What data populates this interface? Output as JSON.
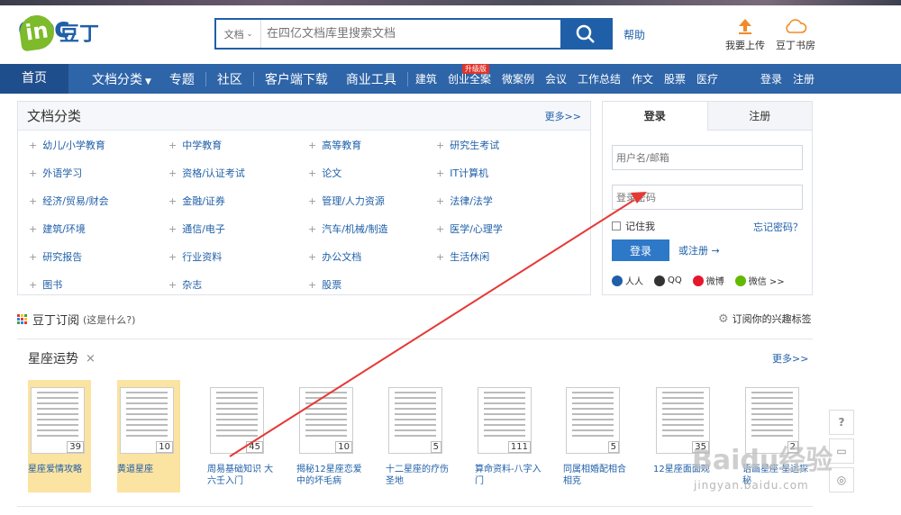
{
  "logo": {
    "brand": "doc",
    "badge": "in",
    "cn": "豆丁"
  },
  "search": {
    "type_label": "文档",
    "placeholder": "在四亿文档库里搜索文档"
  },
  "help": "帮助",
  "tools": [
    {
      "label": "我要上传",
      "icon": "upload-icon"
    },
    {
      "label": "豆丁书房",
      "icon": "cloud-icon"
    }
  ],
  "nav": {
    "main": [
      "首页",
      "文档分类",
      "专题",
      "社区",
      "客户端下载",
      "商业工具"
    ],
    "small": [
      "建筑",
      "创业全案",
      "微案例",
      "会议",
      "工作总结",
      "作文",
      "股票",
      "医疗"
    ],
    "badge": "升级版",
    "login": "登录",
    "register": "注册"
  },
  "categories": {
    "title": "文档分类",
    "more": "更多>>",
    "items": [
      "幼儿/小学教育",
      "中学教育",
      "高等教育",
      "研究生考试",
      "外语学习",
      "资格/认证考试",
      "论文",
      "IT计算机",
      "经济/贸易/财会",
      "金融/证券",
      "管理/人力资源",
      "法律/法学",
      "建筑/环境",
      "通信/电子",
      "汽车/机械/制造",
      "医学/心理学",
      "研究报告",
      "行业资料",
      "办公文档",
      "生活休闲",
      "图书",
      "杂志",
      "股票"
    ]
  },
  "login": {
    "tab_login": "登录",
    "tab_register": "注册",
    "username_placeholder": "用户名/邮箱",
    "password_placeholder": "登录密码",
    "remember": "记住我",
    "forgot": "忘记密码？",
    "submit": "登录",
    "or_register": "或注册 →",
    "social": [
      "人人",
      "QQ",
      "微博",
      "微信 >>"
    ]
  },
  "subscribe": {
    "title": "豆丁订阅",
    "hint": "(这是什么?)",
    "right": "订阅你的兴趣标签"
  },
  "section": {
    "title": "星座运势",
    "close": "×",
    "more": "更多>>"
  },
  "docs": [
    {
      "title": "星座爱情攻略",
      "count": "39"
    },
    {
      "title": "黄道星座",
      "count": "10"
    },
    {
      "title": "周易基础知识 大六壬入门",
      "count": "45"
    },
    {
      "title": "揭秘12星座恋爱中的坏毛病",
      "count": "10"
    },
    {
      "title": "十二星座的疗伤圣地",
      "count": "5"
    },
    {
      "title": "算命资料-八字入门",
      "count": "111"
    },
    {
      "title": "同属相婚配相合相克",
      "count": "5"
    },
    {
      "title": "12星座面面观",
      "count": "35"
    },
    {
      "title": "语画星座·星运探秘",
      "count": "2"
    }
  ],
  "watermark": {
    "main": "Baidu经验",
    "sub": "jingyan.baidu.com"
  },
  "colors": {
    "brand_blue": "#1f5fa8",
    "nav_blue": "#2e64a8",
    "highlight": "#fbe3a1",
    "arrow": "#e53935"
  }
}
